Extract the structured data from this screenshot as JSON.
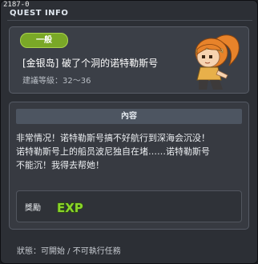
{
  "window": {
    "id_text": "2187-0",
    "title": "QUEST INFO"
  },
  "header": {
    "badge": "一般",
    "quest_name": "[金银岛] 破了个洞的诺特勒斯号",
    "level": "建議等級：32～36",
    "portrait_icon": "girl-with-orange-ponytail-portrait"
  },
  "content": {
    "section_title": "內容",
    "description_lines": [
      "非常情况！诺特勒斯号搞不好航行到深海会沉没！",
      "诺特勒斯号上的船员波尼独自在堵……诺特勒斯号",
      "不能沉！我得去帮她！"
    ],
    "reward_label": "獎勵",
    "reward_icon": "exp-icon",
    "reward_text": "EXP"
  },
  "status": "狀態：可開始 / 不可執行任務",
  "colors": {
    "badge_green": "#7aa827",
    "exp_green": "#8ad42a",
    "panel": "#3b3f47",
    "hair_orange": "#e8832a"
  }
}
